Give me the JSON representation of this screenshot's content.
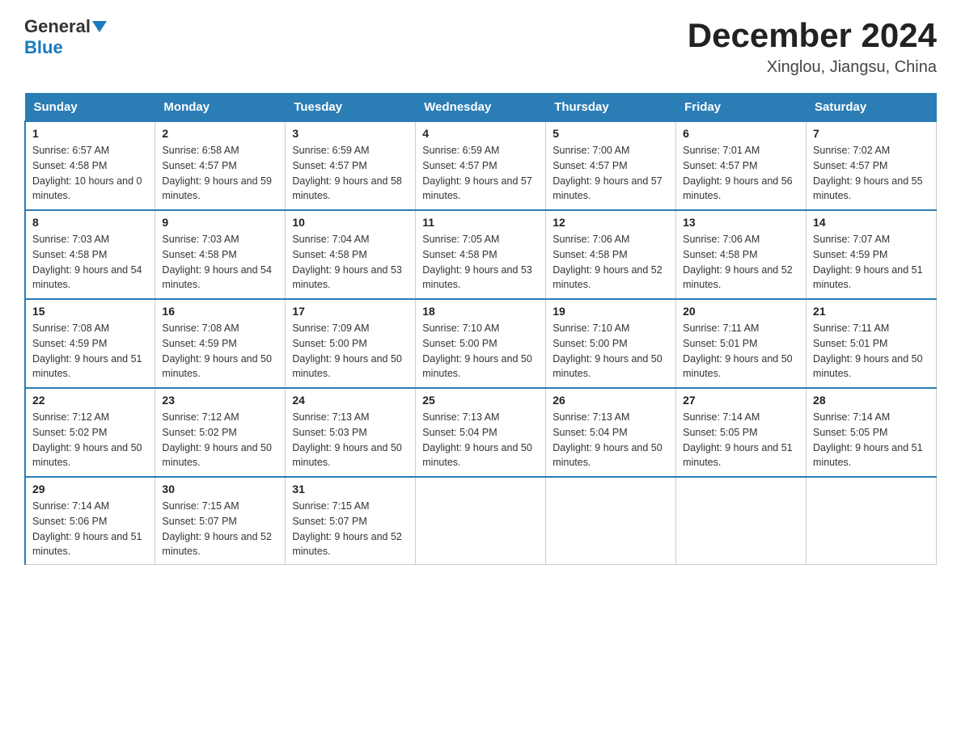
{
  "header": {
    "logo_general": "General",
    "logo_blue": "Blue",
    "month_title": "December 2024",
    "location": "Xinglou, Jiangsu, China"
  },
  "days_of_week": [
    "Sunday",
    "Monday",
    "Tuesday",
    "Wednesday",
    "Thursday",
    "Friday",
    "Saturday"
  ],
  "weeks": [
    [
      {
        "day": "1",
        "sunrise": "Sunrise: 6:57 AM",
        "sunset": "Sunset: 4:58 PM",
        "daylight": "Daylight: 10 hours and 0 minutes."
      },
      {
        "day": "2",
        "sunrise": "Sunrise: 6:58 AM",
        "sunset": "Sunset: 4:57 PM",
        "daylight": "Daylight: 9 hours and 59 minutes."
      },
      {
        "day": "3",
        "sunrise": "Sunrise: 6:59 AM",
        "sunset": "Sunset: 4:57 PM",
        "daylight": "Daylight: 9 hours and 58 minutes."
      },
      {
        "day": "4",
        "sunrise": "Sunrise: 6:59 AM",
        "sunset": "Sunset: 4:57 PM",
        "daylight": "Daylight: 9 hours and 57 minutes."
      },
      {
        "day": "5",
        "sunrise": "Sunrise: 7:00 AM",
        "sunset": "Sunset: 4:57 PM",
        "daylight": "Daylight: 9 hours and 57 minutes."
      },
      {
        "day": "6",
        "sunrise": "Sunrise: 7:01 AM",
        "sunset": "Sunset: 4:57 PM",
        "daylight": "Daylight: 9 hours and 56 minutes."
      },
      {
        "day": "7",
        "sunrise": "Sunrise: 7:02 AM",
        "sunset": "Sunset: 4:57 PM",
        "daylight": "Daylight: 9 hours and 55 minutes."
      }
    ],
    [
      {
        "day": "8",
        "sunrise": "Sunrise: 7:03 AM",
        "sunset": "Sunset: 4:58 PM",
        "daylight": "Daylight: 9 hours and 54 minutes."
      },
      {
        "day": "9",
        "sunrise": "Sunrise: 7:03 AM",
        "sunset": "Sunset: 4:58 PM",
        "daylight": "Daylight: 9 hours and 54 minutes."
      },
      {
        "day": "10",
        "sunrise": "Sunrise: 7:04 AM",
        "sunset": "Sunset: 4:58 PM",
        "daylight": "Daylight: 9 hours and 53 minutes."
      },
      {
        "day": "11",
        "sunrise": "Sunrise: 7:05 AM",
        "sunset": "Sunset: 4:58 PM",
        "daylight": "Daylight: 9 hours and 53 minutes."
      },
      {
        "day": "12",
        "sunrise": "Sunrise: 7:06 AM",
        "sunset": "Sunset: 4:58 PM",
        "daylight": "Daylight: 9 hours and 52 minutes."
      },
      {
        "day": "13",
        "sunrise": "Sunrise: 7:06 AM",
        "sunset": "Sunset: 4:58 PM",
        "daylight": "Daylight: 9 hours and 52 minutes."
      },
      {
        "day": "14",
        "sunrise": "Sunrise: 7:07 AM",
        "sunset": "Sunset: 4:59 PM",
        "daylight": "Daylight: 9 hours and 51 minutes."
      }
    ],
    [
      {
        "day": "15",
        "sunrise": "Sunrise: 7:08 AM",
        "sunset": "Sunset: 4:59 PM",
        "daylight": "Daylight: 9 hours and 51 minutes."
      },
      {
        "day": "16",
        "sunrise": "Sunrise: 7:08 AM",
        "sunset": "Sunset: 4:59 PM",
        "daylight": "Daylight: 9 hours and 50 minutes."
      },
      {
        "day": "17",
        "sunrise": "Sunrise: 7:09 AM",
        "sunset": "Sunset: 5:00 PM",
        "daylight": "Daylight: 9 hours and 50 minutes."
      },
      {
        "day": "18",
        "sunrise": "Sunrise: 7:10 AM",
        "sunset": "Sunset: 5:00 PM",
        "daylight": "Daylight: 9 hours and 50 minutes."
      },
      {
        "day": "19",
        "sunrise": "Sunrise: 7:10 AM",
        "sunset": "Sunset: 5:00 PM",
        "daylight": "Daylight: 9 hours and 50 minutes."
      },
      {
        "day": "20",
        "sunrise": "Sunrise: 7:11 AM",
        "sunset": "Sunset: 5:01 PM",
        "daylight": "Daylight: 9 hours and 50 minutes."
      },
      {
        "day": "21",
        "sunrise": "Sunrise: 7:11 AM",
        "sunset": "Sunset: 5:01 PM",
        "daylight": "Daylight: 9 hours and 50 minutes."
      }
    ],
    [
      {
        "day": "22",
        "sunrise": "Sunrise: 7:12 AM",
        "sunset": "Sunset: 5:02 PM",
        "daylight": "Daylight: 9 hours and 50 minutes."
      },
      {
        "day": "23",
        "sunrise": "Sunrise: 7:12 AM",
        "sunset": "Sunset: 5:02 PM",
        "daylight": "Daylight: 9 hours and 50 minutes."
      },
      {
        "day": "24",
        "sunrise": "Sunrise: 7:13 AM",
        "sunset": "Sunset: 5:03 PM",
        "daylight": "Daylight: 9 hours and 50 minutes."
      },
      {
        "day": "25",
        "sunrise": "Sunrise: 7:13 AM",
        "sunset": "Sunset: 5:04 PM",
        "daylight": "Daylight: 9 hours and 50 minutes."
      },
      {
        "day": "26",
        "sunrise": "Sunrise: 7:13 AM",
        "sunset": "Sunset: 5:04 PM",
        "daylight": "Daylight: 9 hours and 50 minutes."
      },
      {
        "day": "27",
        "sunrise": "Sunrise: 7:14 AM",
        "sunset": "Sunset: 5:05 PM",
        "daylight": "Daylight: 9 hours and 51 minutes."
      },
      {
        "day": "28",
        "sunrise": "Sunrise: 7:14 AM",
        "sunset": "Sunset: 5:05 PM",
        "daylight": "Daylight: 9 hours and 51 minutes."
      }
    ],
    [
      {
        "day": "29",
        "sunrise": "Sunrise: 7:14 AM",
        "sunset": "Sunset: 5:06 PM",
        "daylight": "Daylight: 9 hours and 51 minutes."
      },
      {
        "day": "30",
        "sunrise": "Sunrise: 7:15 AM",
        "sunset": "Sunset: 5:07 PM",
        "daylight": "Daylight: 9 hours and 52 minutes."
      },
      {
        "day": "31",
        "sunrise": "Sunrise: 7:15 AM",
        "sunset": "Sunset: 5:07 PM",
        "daylight": "Daylight: 9 hours and 52 minutes."
      },
      null,
      null,
      null,
      null
    ]
  ]
}
